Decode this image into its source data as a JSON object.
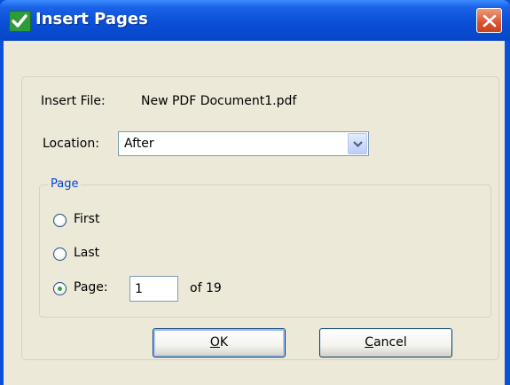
{
  "window": {
    "title": "Insert Pages"
  },
  "form": {
    "insert_file_label": "Insert File:",
    "insert_file_value": "New PDF Document1.pdf",
    "location_label": "Location:",
    "location_value": "After"
  },
  "page_group": {
    "legend": "Page",
    "options": [
      {
        "label": "First",
        "selected": false
      },
      {
        "label": "Last",
        "selected": false
      },
      {
        "label": "Page:",
        "selected": true
      }
    ],
    "page_number": "1",
    "of_text": "of 19"
  },
  "buttons": {
    "ok_accel": "O",
    "ok_rest": "K",
    "cancel_accel": "C",
    "cancel_rest": "ancel"
  },
  "colors": {
    "titlebar": "#0a4fd6",
    "dialog_bg": "#ece9d8",
    "group_legend": "#0046d5",
    "close_button": "#d8542f",
    "radio_dot": "#31a339"
  },
  "icons": {
    "title": "green-checkmark-icon",
    "close": "close-x-icon",
    "dropdown": "chevron-down-icon"
  }
}
